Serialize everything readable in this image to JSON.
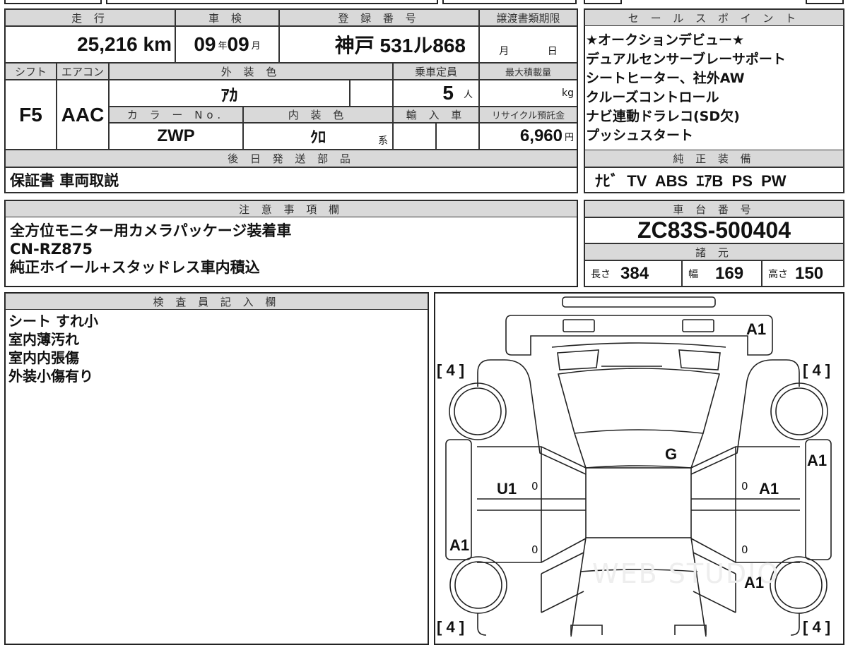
{
  "vehicle": {
    "headers": {
      "mileage": "走 行",
      "inspection": "車 検",
      "registration": "登 録 番 号",
      "transfer_deadline": "譲渡書類期限",
      "shift": "シフト",
      "aircon": "エアコン",
      "exterior_color": "外 装 色",
      "capacity": "乗車定員",
      "max_load": "最大積載量",
      "color_no": "カ ラ ー No.",
      "interior_color": "内 装 色",
      "import": "輸 入 車",
      "recycle": "リサイクル預託金",
      "later_parts": "後 日 発 送 部 品"
    },
    "mileage": "25,216",
    "mileage_unit": "km",
    "inspection_year": "09",
    "year_unit": "年",
    "inspection_month": "09",
    "month_unit": "月",
    "registration": "神戸 531ル868",
    "deadline_month": "月",
    "deadline_day": "日",
    "shift": "F5",
    "aircon": "AAC",
    "exterior_color": "ｱｶ",
    "capacity": "5",
    "capacity_unit": "人",
    "max_load_unit": "kg",
    "color_no": "ZWP",
    "interior_color": "ｸﾛ",
    "interior_suffix": "系",
    "recycle": "6,960",
    "recycle_unit": "円",
    "later_parts": "保証書 車両取説"
  },
  "sales_points": {
    "header": "セ ー ル ス ポ イ ン ト",
    "lines": [
      "★オークションデビュー★",
      "デュアルセンサーブレーサポート",
      "シートヒーター、社外AW",
      "クルーズコントロール",
      "ナビ連動ドラレコ(SD欠)",
      "プッシュスタート"
    ]
  },
  "equipment": {
    "header": "純 正 装 備",
    "value": "ﾅﾋﾞ  TV  ABS  ｴｱB  PS  PW"
  },
  "notes": {
    "header": "注 意 事 項 欄",
    "lines": [
      "全方位モニター用カメラパッケージ装着車",
      "CN-RZ875",
      "純正ホイール+スタッドレス車内積込"
    ]
  },
  "chassis": {
    "header": "車 台 番 号",
    "value": "ZC83S-500404",
    "spec_header": "諸 元",
    "length_label": "長さ",
    "length": "384",
    "width_label": "幅",
    "width": "169",
    "height_label": "高さ",
    "height": "150"
  },
  "inspector": {
    "header": "検 査 員 記 入 欄",
    "lines": [
      "シート すれ小",
      "室内薄汚れ",
      "室内内張傷",
      "外装小傷有り"
    ]
  },
  "diagram": {
    "tire_fl": "[ 4 ]",
    "tire_fr": "[ 4 ]",
    "tire_rl": "[ 4 ]",
    "tire_rr": "[ 4 ]",
    "rear_bumper": "A1",
    "roof": "G",
    "left_front_door": "U1",
    "left_sill": "A1",
    "right_sill": "A1",
    "right_front_door": "A1",
    "right_rear_fender": "A1",
    "door_mark": "0",
    "watermark": "WEB STUDIO"
  }
}
